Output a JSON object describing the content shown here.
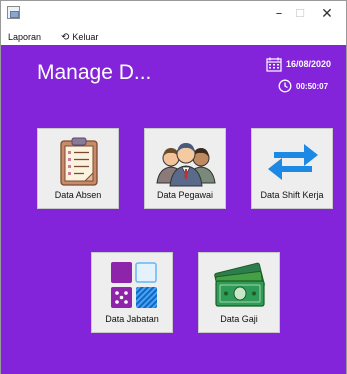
{
  "window": {
    "min_glyph": "–",
    "max_glyph": "☐",
    "close_glyph": "✕"
  },
  "menu": {
    "laporan": "Laporan",
    "keluar": "Keluar",
    "keluar_icon": "exit-icon"
  },
  "header": {
    "title": "Manage D...",
    "date": "16/08/2020",
    "time": "00:50:07"
  },
  "tiles": {
    "data_absen": "Data Absen",
    "data_pegawai": "Data Pegawai",
    "data_shift_kerja": "Data Shift Kerja",
    "data_jabatan": "Data Jabatan",
    "data_gaji": "Data Gaji"
  },
  "colors": {
    "background": "#8324da",
    "tile": "#eeeeee",
    "shift_arrows": "#1e88e5",
    "money": "#2e9b5a"
  }
}
